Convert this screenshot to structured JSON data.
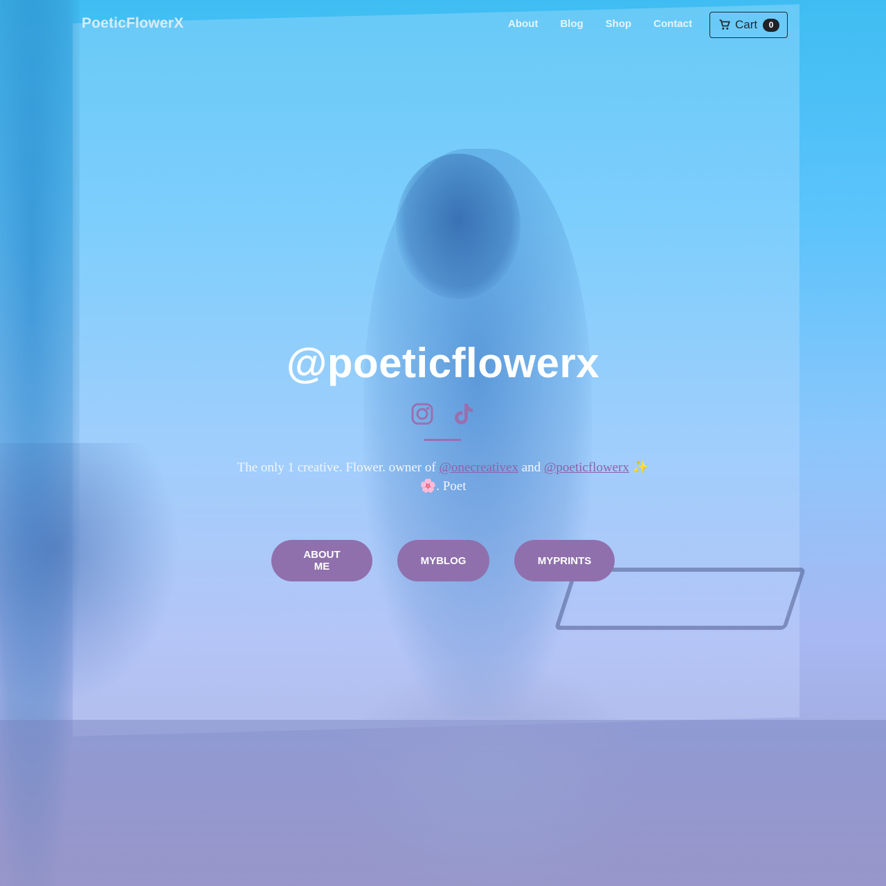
{
  "site": {
    "brand": "PoeticFlowerX"
  },
  "nav": {
    "links": [
      "About",
      "Blog",
      "Shop",
      "Contact"
    ],
    "cart_label": "Cart",
    "cart_count": "0"
  },
  "hero": {
    "title": "@poeticflowerx",
    "socials": [
      {
        "icon": "instagram-icon",
        "color": "#9a6fb0"
      },
      {
        "icon": "tiktok-icon",
        "color": "#9a6fb0"
      }
    ],
    "bio": {
      "part1": "The only 1 creative. Flower. owner of ",
      "link1": "@onecreativex",
      "part2": " and ",
      "link2": "@poeticflowerx",
      "sparkle": "✨",
      "flower": "🌸",
      "part3": ". Poet"
    },
    "buttons": [
      "ABOUT ME",
      "MYBLOG",
      "MYPRINTS"
    ]
  },
  "colors": {
    "accent": "#8f70ad",
    "link": "#8e62a8",
    "gradient_top": "#3fbdf2",
    "gradient_bottom": "#9a9ccb"
  }
}
